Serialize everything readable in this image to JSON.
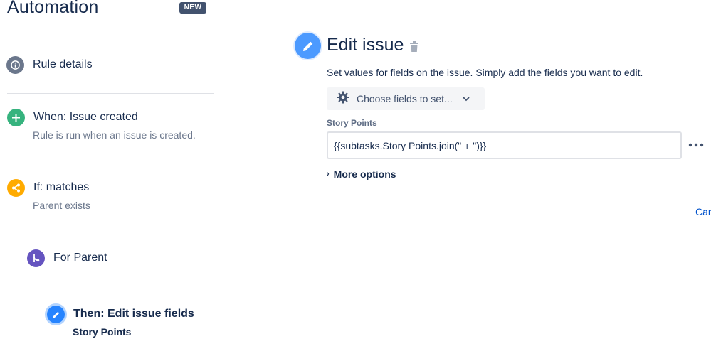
{
  "header": {
    "title": "Automation",
    "badge": "NEW"
  },
  "rule_details": {
    "label": "Rule details",
    "icon": "info-icon"
  },
  "steps": {
    "trigger": {
      "title": "When: Issue created",
      "subtitle": "Rule is run when an issue is created.",
      "icon": "plus-icon",
      "color": "#36b37e"
    },
    "condition": {
      "title": "If: matches",
      "subtitle": "Parent exists",
      "icon": "share-icon",
      "color": "#ffab00"
    },
    "branch": {
      "title": "For Parent",
      "icon": "branch-icon",
      "color": "#6554c0"
    },
    "action": {
      "title": "Then: Edit issue fields",
      "subtitle": "Story Points",
      "icon": "pencil-icon",
      "color": "#2684ff"
    }
  },
  "panel": {
    "title": "Edit issue",
    "description": "Set values for fields on the issue. Simply add the fields you want to edit.",
    "choose_fields_label": "Choose fields to set...",
    "field": {
      "label": "Story Points",
      "value": "{{subtasks.Story Points.join(\" + \")}}"
    },
    "more_options_label": "More options",
    "cancel_label": "Car"
  }
}
